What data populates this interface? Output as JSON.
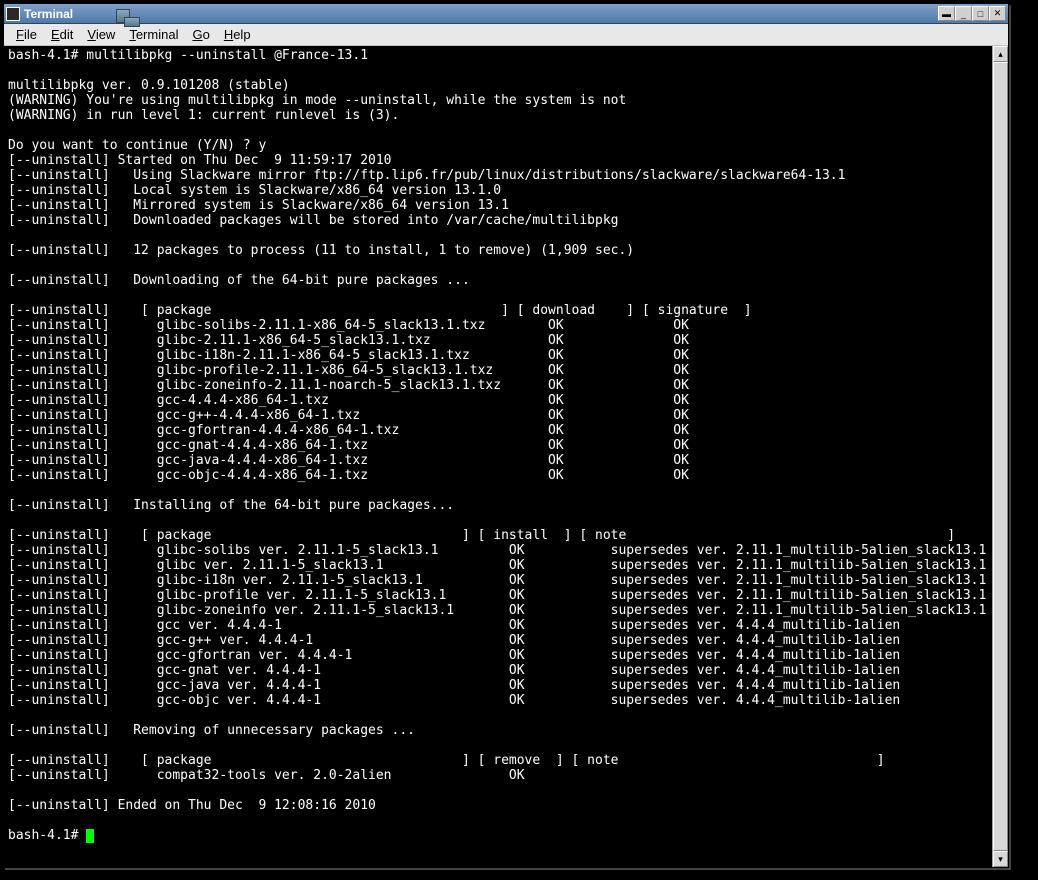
{
  "window": {
    "title": "Terminal"
  },
  "menubar": {
    "items": [
      {
        "label": "File",
        "accel": "F"
      },
      {
        "label": "Edit",
        "accel": "E"
      },
      {
        "label": "View",
        "accel": "V"
      },
      {
        "label": "Terminal",
        "accel": "T"
      },
      {
        "label": "Go",
        "accel": "G"
      },
      {
        "label": "Help",
        "accel": "H"
      }
    ]
  },
  "terminal": {
    "prompt": "bash-4.1# ",
    "command": "multilibpkg --uninstall @France-13.1",
    "version_line": "multilibpkg ver. 0.9.101208 (stable)",
    "warning1": "(WARNING) You're using multilibpkg in mode --uninstall, while the system is not",
    "warning2": "(WARNING) in run level 1: current runlevel is (3).",
    "continue_prompt": "Do you want to continue (Y/N) ? y",
    "started": "[--uninstall] Started on Thu Dec  9 11:59:17 2010",
    "mirror": "[--uninstall]   Using Slackware mirror ftp://ftp.lip6.fr/pub/linux/distributions/slackware/slackware64-13.1",
    "local_sys": "[--uninstall]   Local system is Slackware/x86_64 version 13.1.0",
    "mirrored_sys": "[--uninstall]   Mirrored system is Slackware/x86_64 version 13.1",
    "cache": "[--uninstall]   Downloaded packages will be stored into /var/cache/multilibpkg",
    "packages_summary": "[--uninstall]   12 packages to process (11 to install, 1 to remove) (1,909 sec.)",
    "downloading_header": "[--uninstall]   Downloading of the 64-bit pure packages ...",
    "download_table_header": "[--uninstall]    [ package                                     ] [ download    ] [ signature  ]",
    "downloads": [
      {
        "pkg": "glibc-solibs-2.11.1-x86_64-5_slack13.1.txz",
        "dl": "OK",
        "sig": "OK"
      },
      {
        "pkg": "glibc-2.11.1-x86_64-5_slack13.1.txz",
        "dl": "OK",
        "sig": "OK"
      },
      {
        "pkg": "glibc-i18n-2.11.1-x86_64-5_slack13.1.txz",
        "dl": "OK",
        "sig": "OK"
      },
      {
        "pkg": "glibc-profile-2.11.1-x86_64-5_slack13.1.txz",
        "dl": "OK",
        "sig": "OK"
      },
      {
        "pkg": "glibc-zoneinfo-2.11.1-noarch-5_slack13.1.txz",
        "dl": "OK",
        "sig": "OK"
      },
      {
        "pkg": "gcc-4.4.4-x86_64-1.txz",
        "dl": "OK",
        "sig": "OK"
      },
      {
        "pkg": "gcc-g++-4.4.4-x86_64-1.txz",
        "dl": "OK",
        "sig": "OK"
      },
      {
        "pkg": "gcc-gfortran-4.4.4-x86_64-1.txz",
        "dl": "OK",
        "sig": "OK"
      },
      {
        "pkg": "gcc-gnat-4.4.4-x86_64-1.txz",
        "dl": "OK",
        "sig": "OK"
      },
      {
        "pkg": "gcc-java-4.4.4-x86_64-1.txz",
        "dl": "OK",
        "sig": "OK"
      },
      {
        "pkg": "gcc-objc-4.4.4-x86_64-1.txz",
        "dl": "OK",
        "sig": "OK"
      }
    ],
    "installing_header": "[--uninstall]   Installing of the 64-bit pure packages...",
    "install_table_header": "[--uninstall]    [ package                                ] [ install  ] [ note                                         ]",
    "installs": [
      {
        "pkg": "glibc-solibs ver. 2.11.1-5_slack13.1",
        "inst": "OK",
        "note": "supersedes ver. 2.11.1_multilib-5alien_slack13.1"
      },
      {
        "pkg": "glibc ver. 2.11.1-5_slack13.1",
        "inst": "OK",
        "note": "supersedes ver. 2.11.1_multilib-5alien_slack13.1"
      },
      {
        "pkg": "glibc-i18n ver. 2.11.1-5_slack13.1",
        "inst": "OK",
        "note": "supersedes ver. 2.11.1_multilib-5alien_slack13.1"
      },
      {
        "pkg": "glibc-profile ver. 2.11.1-5_slack13.1",
        "inst": "OK",
        "note": "supersedes ver. 2.11.1_multilib-5alien_slack13.1"
      },
      {
        "pkg": "glibc-zoneinfo ver. 2.11.1-5_slack13.1",
        "inst": "OK",
        "note": "supersedes ver. 2.11.1_multilib-5alien_slack13.1"
      },
      {
        "pkg": "gcc ver. 4.4.4-1",
        "inst": "OK",
        "note": "supersedes ver. 4.4.4_multilib-1alien"
      },
      {
        "pkg": "gcc-g++ ver. 4.4.4-1",
        "inst": "OK",
        "note": "supersedes ver. 4.4.4_multilib-1alien"
      },
      {
        "pkg": "gcc-gfortran ver. 4.4.4-1",
        "inst": "OK",
        "note": "supersedes ver. 4.4.4_multilib-1alien"
      },
      {
        "pkg": "gcc-gnat ver. 4.4.4-1",
        "inst": "OK",
        "note": "supersedes ver. 4.4.4_multilib-1alien"
      },
      {
        "pkg": "gcc-java ver. 4.4.4-1",
        "inst": "OK",
        "note": "supersedes ver. 4.4.4_multilib-1alien"
      },
      {
        "pkg": "gcc-objc ver. 4.4.4-1",
        "inst": "OK",
        "note": "supersedes ver. 4.4.4_multilib-1alien"
      }
    ],
    "removing_header": "[--uninstall]   Removing of unnecessary packages ...",
    "remove_table_header": "[--uninstall]    [ package                                ] [ remove  ] [ note                                 ]",
    "removes": [
      {
        "pkg": "compat32-tools ver. 2.0-2alien",
        "rm": "OK",
        "note": ""
      }
    ],
    "ended": "[--uninstall] Ended on Thu Dec  9 12:08:16 2010",
    "final_prompt": "bash-4.1# "
  }
}
